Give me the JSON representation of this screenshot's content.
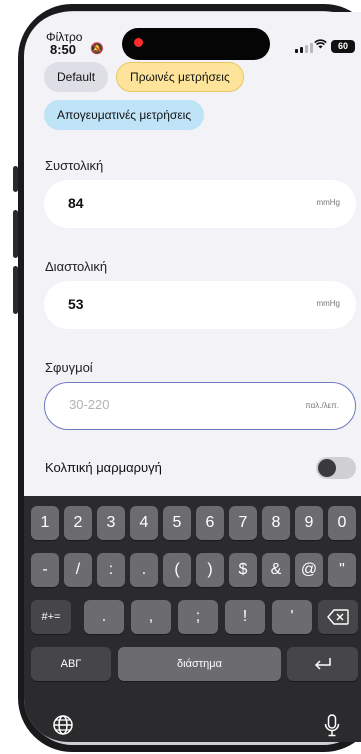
{
  "status_bar": {
    "overlay_heading": "Φίλτρο",
    "time": "8:50",
    "battery": "60"
  },
  "filters": {
    "chips": [
      "Default",
      "Πρωινές μετρήσεις",
      "Απογευματινές μετρήσεις"
    ]
  },
  "systolic": {
    "label": "Συστολική",
    "value": "84",
    "unit": "mmHg"
  },
  "diastolic": {
    "label": "Διαστολική",
    "value": "53",
    "unit": "mmHg"
  },
  "pulse": {
    "label": "Σφυγμοί",
    "placeholder": "30-220",
    "unit": "παλ./λεπ."
  },
  "afib": {
    "label": "Κολπική μαρμαρυγή",
    "enabled": false
  },
  "keyboard": {
    "row1": [
      "1",
      "2",
      "3",
      "4",
      "5",
      "6",
      "7",
      "8",
      "9",
      "0"
    ],
    "row2": [
      "-",
      "/",
      ":",
      ".",
      "(",
      ")",
      "$",
      "&",
      "@",
      "\""
    ],
    "row3_left": "#+=",
    "row3": [
      ".",
      ",",
      ";",
      "!",
      "'"
    ],
    "abc": "ΑΒΓ",
    "space": "διάστημα",
    "return_icon": "return-icon",
    "globe_icon": "globe-icon",
    "mic_icon": "microphone-icon",
    "delete_icon": "backspace-icon"
  }
}
